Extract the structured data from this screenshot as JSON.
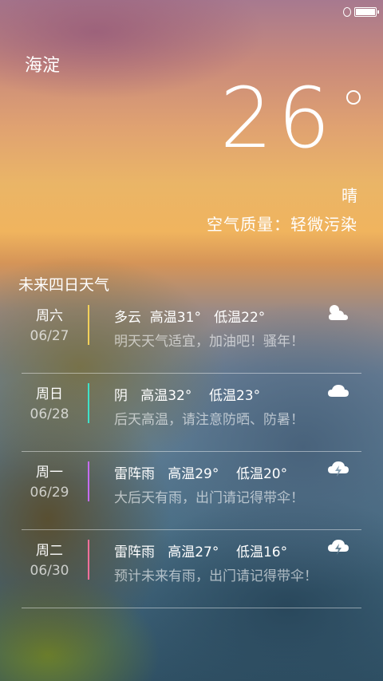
{
  "location": "海淀",
  "current": {
    "temperature": "26",
    "condition": "晴",
    "air_quality": "空气质量：轻微污染"
  },
  "forecast_title": "未来四日天气",
  "forecast": [
    {
      "day": "周六",
      "date": "06/27",
      "summary": "多云  高温31°   低温22°",
      "tip": "明天天气适宜，加油吧！骚年！",
      "accent": "#f2d05a",
      "icon": "partly-cloudy-icon"
    },
    {
      "day": "周日",
      "date": "06/28",
      "summary": "阴   高温32°    低温23°",
      "tip": "后天高温，请注意防晒、防暑！",
      "accent": "#3fe0c8",
      "icon": "cloud-icon"
    },
    {
      "day": "周一",
      "date": "06/29",
      "summary": "雷阵雨   高温29°    低温20°",
      "tip": "大后天有雨，出门请记得带伞！",
      "accent": "#c56cf0",
      "icon": "thunderstorm-icon"
    },
    {
      "day": "周二",
      "date": "06/30",
      "summary": "雷阵雨   高温27°    低温16°",
      "tip": "预计未来有雨，出门请记得带伞！",
      "accent": "#ff6f9a",
      "icon": "thunderstorm-icon"
    }
  ]
}
